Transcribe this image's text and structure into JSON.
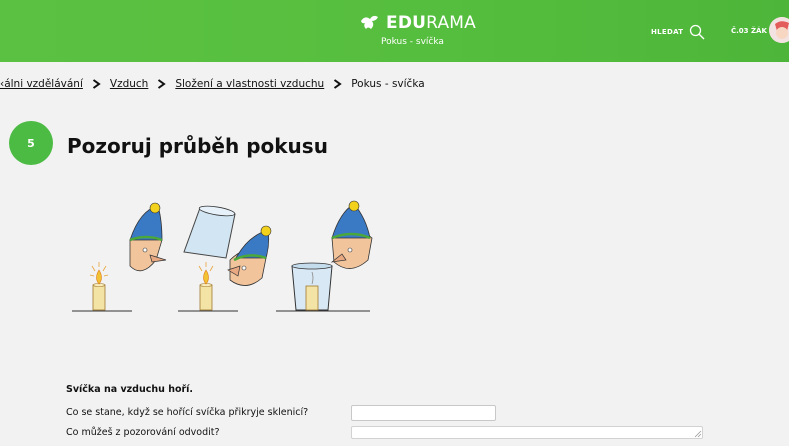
{
  "header": {
    "brand_bold": "EDU",
    "brand_rest": "RAMA",
    "subtitle": "Pokus - svíčka",
    "search_label": "HLEDAT",
    "user_label": "Č.03 ŽÁK"
  },
  "breadcrumb": {
    "items": [
      "‹álni vzdělávání",
      "Vzduch",
      "Složení a vlastnosti vzduchu"
    ],
    "current": "Pokus - svíčka"
  },
  "section": {
    "step_number": "5",
    "title": "Pozoruj průběh pokusu"
  },
  "task": {
    "statement": "Svíčka na vzduchu hoří.",
    "question_1": "Co se stane, když se hořící svíčka přikryje sklenicí?",
    "question_2": "Co můžeš z pozorování odvodit?",
    "answer_1": "",
    "answer_2": ""
  },
  "colors": {
    "header_green": "#56be3e",
    "step_green": "#4cbb43"
  }
}
